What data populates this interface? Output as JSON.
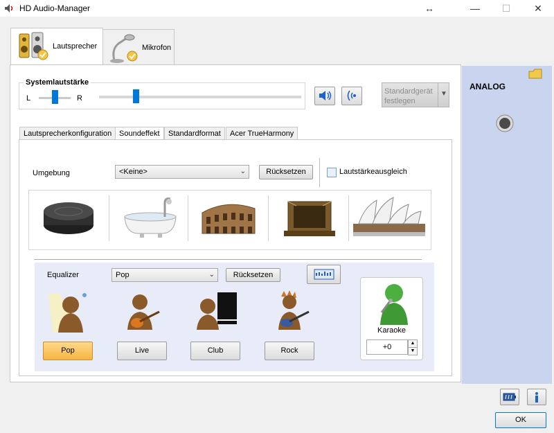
{
  "window": {
    "title": "HD Audio-Manager",
    "restore_glyph": "↔",
    "minimize_glyph": "—",
    "maximize_glyph": "☐",
    "close_glyph": "✕"
  },
  "device_tabs": [
    {
      "label": "Lautsprecher",
      "active": true,
      "icon": "speaker-icon"
    },
    {
      "label": "Mikrofon",
      "active": false,
      "icon": "microphone-icon"
    }
  ],
  "volume": {
    "heading": "Systemlautstärke",
    "left_label": "L",
    "right_label": "R",
    "balance": 0.5,
    "level": 0.18
  },
  "default_device_button": "Standardgerät\nfestlegen",
  "sub_tabs": [
    {
      "label": "Lautsprecherkonfiguration",
      "active": false
    },
    {
      "label": "Soundeffekt",
      "active": true
    },
    {
      "label": "Standardformat",
      "active": false
    },
    {
      "label": "Acer TrueHarmony",
      "active": false
    }
  ],
  "environment": {
    "label": "Umgebung",
    "selected": "<Keine>",
    "reset_label": "Rücksetzen",
    "loudness_label": "Lautstärkeausgleich",
    "loudness_checked": false,
    "presets": [
      "stone-disc-icon",
      "bathtub-icon",
      "colosseum-icon",
      "stage-icon",
      "opera-house-icon"
    ]
  },
  "equalizer": {
    "label": "Equalizer",
    "selected": "Pop",
    "reset_label": "Rücksetzen",
    "presets": [
      {
        "label": "Pop",
        "active": true,
        "icon": "pop-singer-icon"
      },
      {
        "label": "Live",
        "active": false,
        "icon": "guitarist-icon"
      },
      {
        "label": "Club",
        "active": false,
        "icon": "pianist-icon"
      },
      {
        "label": "Rock",
        "active": false,
        "icon": "rock-guitarist-icon"
      }
    ]
  },
  "karaoke": {
    "label": "Karaoke",
    "value": "+0"
  },
  "right_panel": {
    "title": "ANALOG"
  },
  "ok_label": "OK",
  "colors": {
    "accent_blue": "#0078d7",
    "right_panel_bg": "#c9d5ee",
    "inner_bg": "#e8ecf8",
    "active_preset": "#f7b542"
  }
}
